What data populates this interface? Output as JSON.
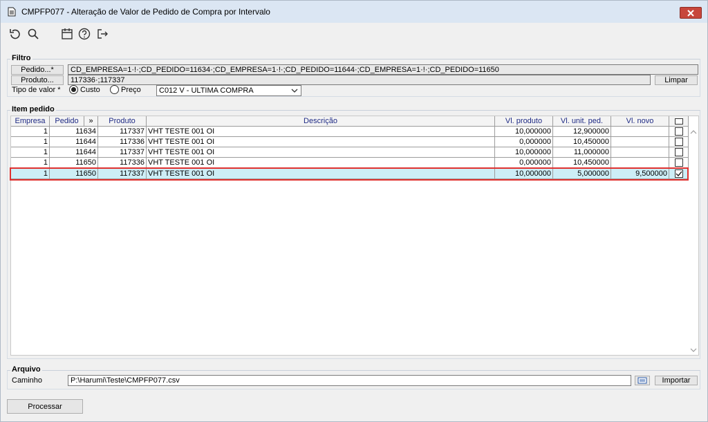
{
  "window": {
    "title": "CMPFP077 - Alteração de Valor de Pedido de Compra por Intervalo"
  },
  "toolbar": {
    "icons": [
      "undo-icon",
      "search-icon",
      "calendar-icon",
      "help-icon",
      "exit-icon"
    ]
  },
  "filtro": {
    "title": "Filtro",
    "pedido_button": "Pedido...*",
    "pedido_value": "CD_EMPRESA=1·!·;CD_PEDIDO=11634·;CD_EMPRESA=1·!·;CD_PEDIDO=11644·;CD_EMPRESA=1·!·;CD_PEDIDO=11650",
    "produto_button": "Produto...",
    "produto_value": "117336·;117337",
    "limpar_button": "Limpar",
    "tipo_label": "Tipo de valor *",
    "radio_custo": "Custo",
    "radio_preco": "Preço",
    "selected_radio": "Custo",
    "select_value": "C012 V - ULTIMA COMPRA"
  },
  "item_pedido": {
    "title": "Item pedido",
    "columns": [
      "Empresa",
      "Pedido",
      "»",
      "Produto",
      "Descrição",
      "Vl. produto",
      "Vl. unit. ped.",
      "Vl. novo"
    ],
    "rows": [
      {
        "empresa": "1",
        "pedido": "11634",
        "produto": "117337",
        "descricao": "VHT TESTE 001 OI",
        "vl_produto": "10,000000",
        "vl_unit": "12,900000",
        "vl_novo": "",
        "checked": false
      },
      {
        "empresa": "1",
        "pedido": "11644",
        "produto": "117336",
        "descricao": "VHT TESTE 001 OI",
        "vl_produto": "0,000000",
        "vl_unit": "10,450000",
        "vl_novo": "",
        "checked": false
      },
      {
        "empresa": "1",
        "pedido": "11644",
        "produto": "117337",
        "descricao": "VHT TESTE 001 OI",
        "vl_produto": "10,000000",
        "vl_unit": "11,000000",
        "vl_novo": "",
        "checked": false
      },
      {
        "empresa": "1",
        "pedido": "11650",
        "produto": "117336",
        "descricao": "VHT TESTE 001 OI",
        "vl_produto": "0,000000",
        "vl_unit": "10,450000",
        "vl_novo": "",
        "checked": false
      },
      {
        "empresa": "1",
        "pedido": "11650",
        "produto": "117337",
        "descricao": "VHT TESTE 001 OI",
        "vl_produto": "10,000000",
        "vl_unit": "5,000000",
        "vl_novo": "9,500000",
        "checked": true
      }
    ]
  },
  "arquivo": {
    "title": "Arquivo",
    "caminho_label": "Caminho",
    "caminho_value": "P:\\Harumi\\Teste\\CMPFP077.csv",
    "importar_button": "Importar"
  },
  "footer": {
    "processar_button": "Processar"
  },
  "colors": {
    "accent_red": "#e0312f",
    "selected_row": "#cdeef6",
    "header_text": "#1e2a84"
  }
}
